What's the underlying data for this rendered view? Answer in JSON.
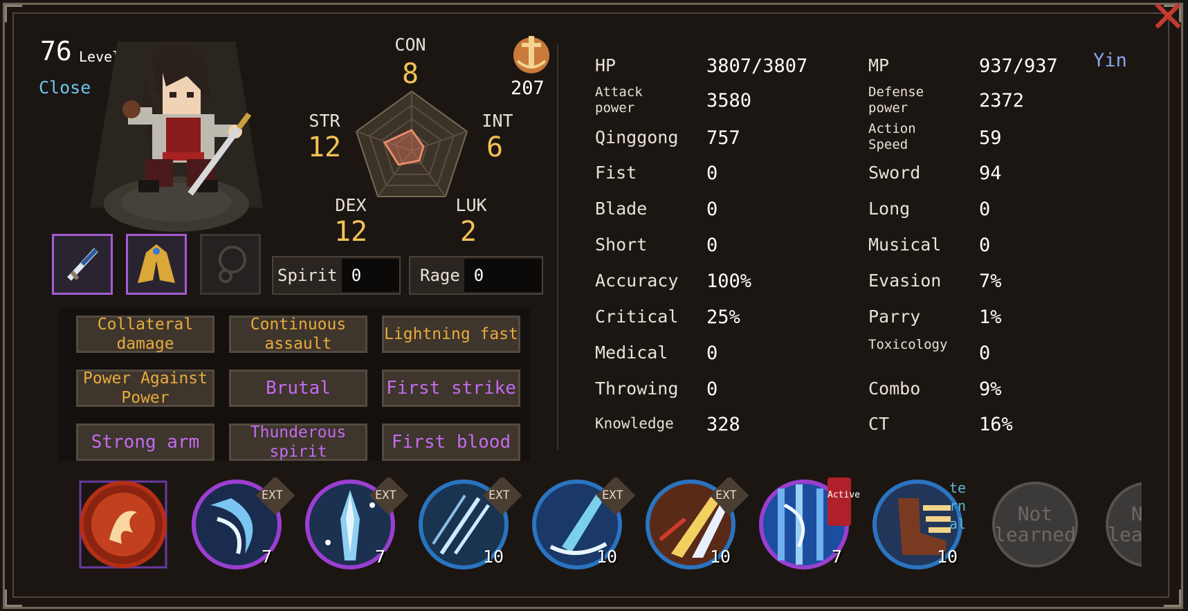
{
  "window": {
    "close_icon": "close-x-icon"
  },
  "character": {
    "level_value": "76",
    "level_label": "Level",
    "close_label": "Close",
    "emblem_value": "207",
    "faction": "Yin"
  },
  "equipment": [
    {
      "name": "sword",
      "icon": "sword-icon",
      "filled": true
    },
    {
      "name": "robe",
      "icon": "robe-icon",
      "filled": true
    },
    {
      "name": "accessory",
      "icon": "accessory-slot-icon",
      "filled": false
    }
  ],
  "attributes": {
    "con": {
      "label": "CON",
      "value": "8"
    },
    "str": {
      "label": "STR",
      "value": "12"
    },
    "int": {
      "label": "INT",
      "value": "6"
    },
    "dex": {
      "label": "DEX",
      "value": "12"
    },
    "luk": {
      "label": "LUK",
      "value": "2"
    }
  },
  "resources": {
    "spirit": {
      "label": "Spirit",
      "value": "0"
    },
    "rage": {
      "label": "Rage",
      "value": "0"
    }
  },
  "traits": [
    {
      "label": "Collateral damage",
      "color": "gold"
    },
    {
      "label": "Continuous assault",
      "color": "gold"
    },
    {
      "label": "Lightning fast",
      "color": "gold"
    },
    {
      "label": "Power Against Power",
      "color": "gold"
    },
    {
      "label": "Brutal",
      "color": "purple"
    },
    {
      "label": "First strike",
      "color": "purple"
    },
    {
      "label": "Strong arm",
      "color": "purple"
    },
    {
      "label": "Thunderous spirit",
      "color": "purple"
    },
    {
      "label": "First blood",
      "color": "purple"
    }
  ],
  "stats_left": [
    {
      "label": "HP",
      "value": "3807/3807"
    },
    {
      "label": "Attack power",
      "value": "3580"
    },
    {
      "label": "Qinggong",
      "value": "757"
    },
    {
      "label": "Fist",
      "value": "0"
    },
    {
      "label": "Blade",
      "value": "0"
    },
    {
      "label": "Short",
      "value": "0"
    },
    {
      "label": "Accuracy",
      "value": "100%"
    },
    {
      "label": "Critical",
      "value": "25%"
    },
    {
      "label": "Medical",
      "value": "0"
    },
    {
      "label": "Throwing",
      "value": "0"
    },
    {
      "label": "Knowledge",
      "value": "328"
    }
  ],
  "stats_right": [
    {
      "label": "MP",
      "value": "937/937"
    },
    {
      "label": "Defense power",
      "value": "2372"
    },
    {
      "label": "Action Speed",
      "value": "59"
    },
    {
      "label": "Sword",
      "value": "94"
    },
    {
      "label": "Long",
      "value": "0"
    },
    {
      "label": "Musical",
      "value": "0"
    },
    {
      "label": "Evasion",
      "value": "7%"
    },
    {
      "label": "Parry",
      "value": "1%"
    },
    {
      "label": "Toxicology",
      "value": "0"
    },
    {
      "label": "Combo",
      "value": "9%"
    },
    {
      "label": "CT",
      "value": "16%"
    }
  ],
  "skills": [
    {
      "icon": "fire-dragon-skill-icon",
      "level": "",
      "badge": ""
    },
    {
      "icon": "blue-wave-skill-icon",
      "level": "7",
      "badge": "EXT"
    },
    {
      "icon": "ice-crystal-skill-icon",
      "level": "7",
      "badge": "EXT"
    },
    {
      "icon": "slash-skill-icon",
      "level": "10",
      "badge": "EXT"
    },
    {
      "icon": "blade-skill-icon",
      "level": "10",
      "badge": "EXT"
    },
    {
      "icon": "golden-strike-skill-icon",
      "level": "10",
      "badge": "EXT"
    },
    {
      "icon": "ice-wind-skill-icon",
      "level": "7",
      "badge": "Active"
    },
    {
      "icon": "boot-skill-icon",
      "level": "10",
      "badge": "Internal"
    },
    {
      "icon": "not-learned-slot",
      "level": "",
      "badge": "",
      "text": "Not learned"
    },
    {
      "icon": "not-learned-slot",
      "level": "",
      "badge": "",
      "text": "Not learned"
    }
  ],
  "colors": {
    "gold": "#f2c254",
    "trait_gold": "#e9ac3e",
    "purple": "#c46cf0",
    "cyan": "#6ac6ee",
    "close_red": "#c53a2e"
  }
}
